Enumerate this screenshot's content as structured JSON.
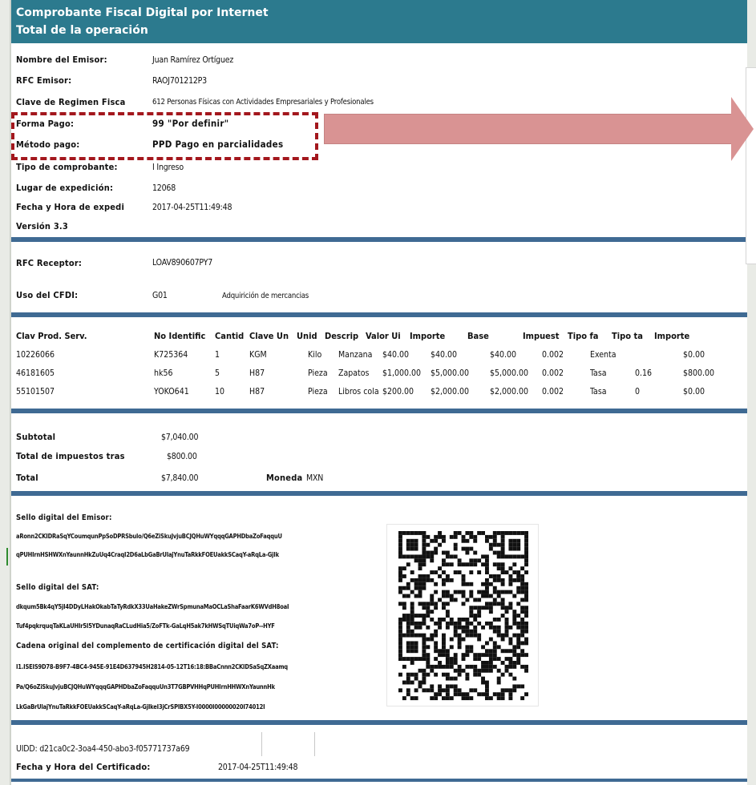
{
  "header": {
    "title": "Comprobante Fiscal Digital por Internet",
    "subtitle": "Total de la operación"
  },
  "emisor": {
    "nombre_label": "Nombre del Emisor:",
    "nombre_value": "Juan Ramírez Ortíguez",
    "rfc_label": "RFC Emisor:",
    "rfc_value": "RAOJ701212P3",
    "regimen_label": "Clave de Regimen Fisca",
    "regimen_value": "612 Personas Físicas con Actividades Empresariales y Profesionales",
    "forma_pago_label": "Forma Pago:",
    "forma_pago_value": "99 \"Por definir\"",
    "metodo_pago_label": "Método pago:",
    "metodo_pago_value": "PPD Pago en parcialidades",
    "tipo_label": "Tipo de comprobante:",
    "tipo_value": "I Ingreso",
    "lugar_label": "Lugar de expedición:",
    "lugar_value": "12068",
    "fecha_label": "Fecha y Hora de expedi",
    "fecha_value": "2017-04-25T11:49:48",
    "version_label": "Versión 3.3"
  },
  "receptor": {
    "rfc_label": "RFC Receptor:",
    "rfc_value": "LOAV890607PY7",
    "uso_label": "Uso del CFDI:",
    "uso_code": "G01",
    "uso_desc": "Adquirición de mercancias"
  },
  "conceptos": {
    "headers": [
      "Clav Prod. Serv.",
      "No Identific",
      "Cantid",
      "Clave Un",
      "Unid",
      "Descrip",
      "Valor Ui",
      "Importe",
      "Base",
      "Impuest",
      "Tipo fa",
      "Tipo ta",
      "Importe"
    ],
    "rows": [
      [
        "10226066",
        "K725364",
        "1",
        "KGM",
        "Kilo",
        "Manzana",
        "$40.00",
        "$40.00",
        "$40.00",
        "0.002",
        "Exenta",
        "",
        "$0.00"
      ],
      [
        "46181605",
        "hk56",
        "5",
        "H87",
        "Pieza",
        "Zapatos",
        "$1,000.00",
        "$5,000.00",
        "$5,000.00",
        "0.002",
        "Tasa",
        "0.16",
        "$800.00"
      ],
      [
        "55101507",
        "YOKO641",
        "10",
        "H87",
        "Pieza",
        "Libros cola",
        "$200.00",
        "$2,000.00",
        "$2,000.00",
        "0.002",
        "Tasa",
        "0",
        "$0.00"
      ]
    ]
  },
  "totales": {
    "subtotal_label": "Subtotal",
    "subtotal_value": "$7,040.00",
    "impuestos_label": "Total de impuestos tras",
    "impuestos_value": "$800.00",
    "total_label": "Total",
    "total_value": "$7,840.00",
    "moneda_label": "Moneda",
    "moneda_value": "MXN"
  },
  "sellos": {
    "emisor_label": "Sello digital del Emisor:",
    "emisor_line1": "aRonn2CKIDRaSqYCoumqunPpSoDPRSbulo/Q6eZiSkuJvjuBCJQHuWYqqqGAPHDbaZoFaqquU",
    "emisor_line2": "qPUHIrnHSHWXnYaunnHkZuUq4CraqI2D6aLbGaBrUlajYnuTaRkkFOEUakkSCaqY-aRqLa-GjIk",
    "sat_label": "Sello digital del SAT:",
    "sat_line1": "dkqum5Bk4qY5jI4DDyLHakOkabTaTyRdkX33UaHakeZWrSpmunaMaOCLaShaFaarK6WVdH8oaI",
    "sat_line2": "Tuf4pqkrquqTaKLaUHIr5I5YDunaqRaCLudHia5/ZoFTk-GaLqH5ak7kHWSqTUiqWa7oP--HYF",
    "cadena_label": "Cadena original del complemento de certificación digital del SAT:",
    "cadena_line1": "I1.ISEIS9D78-B9F7-4BC4-945E-91E4D637945H2814-05-12T16:18:BBaCnnn2CKIDSaSqZXaamq",
    "cadena_line2": "Pa/Q6oZiSkuJvjuBCJQHuWYqqqGAPHDbaZoFaqquUn3T7GBPVHHqPUHIrnHHWXnYaunnHk",
    "cadena_line3": "LkGaBrUlajYnuTaRkkFOEUakkSCaqY-aRqLa-GjIkeI3jCrSPIBX5Y-I0000I00000020I74012I"
  },
  "footer": {
    "uuid": "UIDD: d21ca0c2-3oa4-450-abo3-f05771737a69",
    "fecha_cert_label": "Fecha y Hora del Certificado:",
    "fecha_cert_value": "2017-04-25T11:49:48"
  },
  "annotation": {
    "highlight_color": "#a3171d",
    "arrow_color": "#d99393"
  }
}
